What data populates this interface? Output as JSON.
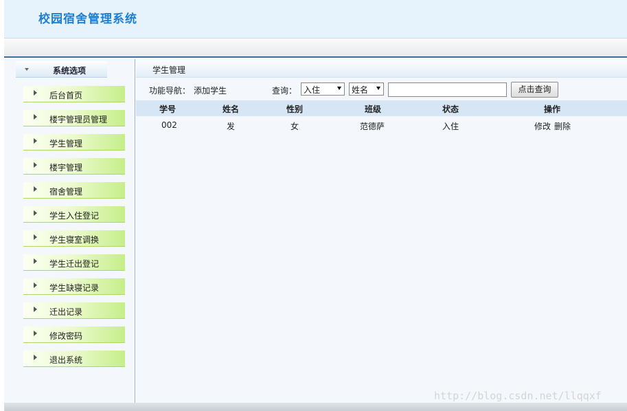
{
  "app": {
    "title": "校园宿舍管理系统"
  },
  "sidebar": {
    "header": "系统选项",
    "items": [
      {
        "label": "后台首页"
      },
      {
        "label": "楼宇管理员管理"
      },
      {
        "label": "学生管理"
      },
      {
        "label": "楼宇管理"
      },
      {
        "label": "宿舍管理"
      },
      {
        "label": "学生入住登记"
      },
      {
        "label": "学生寝室调换"
      },
      {
        "label": "学生迁出登记"
      },
      {
        "label": "学生缺寝记录"
      },
      {
        "label": "迁出记录"
      },
      {
        "label": "修改密码"
      },
      {
        "label": "退出系统"
      }
    ]
  },
  "main": {
    "title": "学生管理",
    "toolbar": {
      "nav_label": "功能导航：",
      "nav_link": "添加学生",
      "query_label": "查询：",
      "status_select": "入住",
      "field_select": "姓名",
      "search_value": "",
      "search_button": "点击查询"
    },
    "table": {
      "headers": [
        "学号",
        "姓名",
        "性别",
        "班级",
        "状态",
        "操作"
      ],
      "rows": [
        {
          "id": "002",
          "name": "发",
          "gender": "女",
          "class": "范德萨",
          "status": "入住",
          "edit": "修改",
          "delete": "删除"
        }
      ]
    }
  },
  "watermark": "http://blog.csdn.net/llqqxf"
}
